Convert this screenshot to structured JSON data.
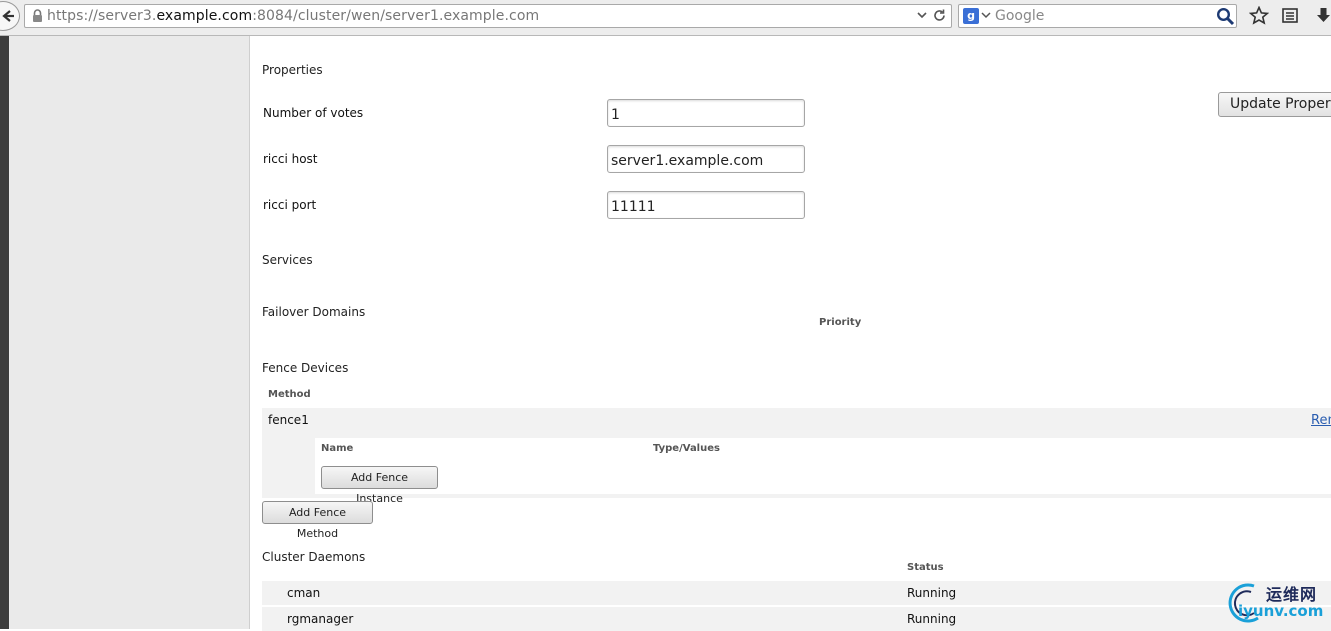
{
  "browser": {
    "url_prefix": "https://server3.",
    "url_domain": "example.com",
    "url_suffix": ":8084/cluster/wen/server1.example.com",
    "search_engine": "Google"
  },
  "node": {
    "properties_title": "Properties",
    "votes_label": "Number of votes",
    "votes_value": "1",
    "ricci_host_label": "ricci host",
    "ricci_host_value": "server1.example.com",
    "ricci_port_label": "ricci port",
    "ricci_port_value": "11111",
    "update_button": "Update Properties"
  },
  "services": {
    "title": "Services"
  },
  "failover": {
    "title": "Failover Domains",
    "priority_header": "Priority"
  },
  "fence": {
    "title": "Fence Devices",
    "method_header": "Method",
    "method_name": "fence1",
    "remove_link": "Remove",
    "name_header": "Name",
    "type_header": "Type/Values",
    "add_instance_button": "Add Fence Instance",
    "add_method_button": "Add Fence Method"
  },
  "daemons": {
    "title": "Cluster Daemons",
    "status_header": "Status",
    "rows": [
      {
        "name": "cman",
        "status": "Running"
      },
      {
        "name": "rgmanager",
        "status": "Running"
      }
    ]
  },
  "watermark": {
    "top": "运维网",
    "bottom": "iyunv.com"
  }
}
